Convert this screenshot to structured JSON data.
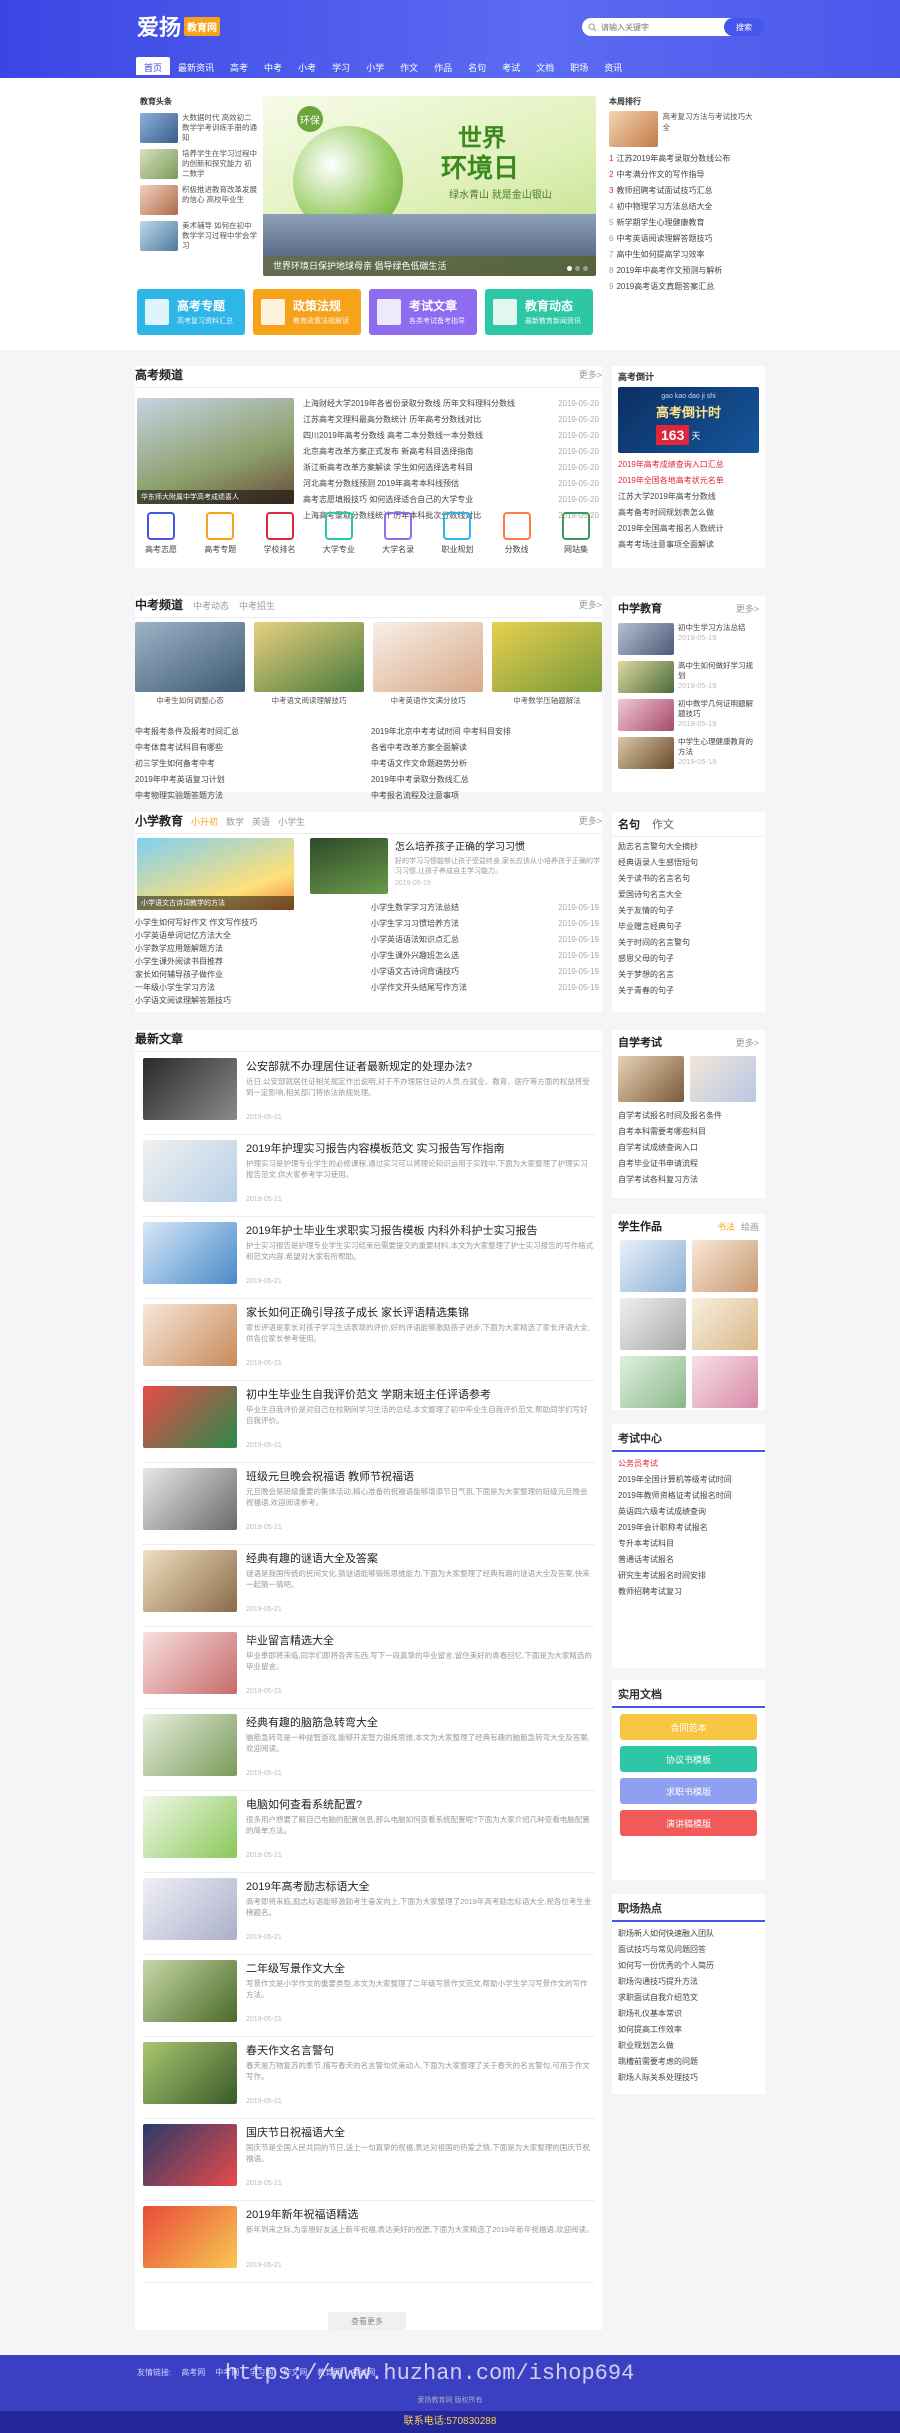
{
  "brand": {
    "name": "爱扬",
    "badge": "教育网"
  },
  "search": {
    "placeholder": "请输入关键字",
    "button": "搜索"
  },
  "nav": [
    "首页",
    "最新资讯",
    "高考",
    "中考",
    "小考",
    "学习",
    "小学",
    "作文",
    "作品",
    "名句",
    "考试",
    "文档",
    "职场",
    "资讯"
  ],
  "hero": {
    "headline_list_title": "教育头条",
    "headlines": [
      "大数据时代 高效初二数学学考训练手册的通知",
      "培养学生在学习过程中的创新和探究能力 初二数学",
      "积极推进教育改革发展的信心 高校毕业生",
      "美术辅导 如何在初中数学学习过程中学会学习"
    ],
    "banner": {
      "tag": "环保",
      "line1": "世界",
      "line2": "环境日",
      "sub": "绿水青山 就是金山银山",
      "caption": "世界环境日保护地球母亲 倡导绿色低碳生活"
    },
    "weekly_title": "本周排行",
    "weekly": [
      "高考复习方法与考试技巧大全",
      "江苏2019年高考录取分数线公布",
      "中考满分作文的写作指导",
      "教师招聘考试面试技巧汇总",
      "初中物理学习方法总结大全",
      "新学期学生心理健康教育",
      "中考英语阅读理解答题技巧",
      "高中生如何提高学习效率",
      "2019年中高考作文预测与解析",
      "2019高考语文真题答案汇总"
    ]
  },
  "cards": [
    {
      "title": "高考专题",
      "sub": "高考复习资料汇总"
    },
    {
      "title": "政策法规",
      "sub": "教育政策法规解读"
    },
    {
      "title": "考试文章",
      "sub": "各类考试备考指导"
    },
    {
      "title": "教育动态",
      "sub": "最新教育新闻资讯"
    }
  ],
  "gaokao": {
    "title": "高考频道",
    "more": "更多>",
    "photo_caption": "华东师大附属中学高考成绩喜人",
    "items": [
      {
        "t": "上海财经大学2019年各省份录取分数线 历年文科理科分数线",
        "d": "2019-05-20"
      },
      {
        "t": "江苏高考文理科最高分数统计 历年高考分数线对比",
        "d": "2019-05-20"
      },
      {
        "t": "四川2019年高考分数线 高考二本分数线一本分数线",
        "d": "2019-05-20"
      },
      {
        "t": "北京高考改革方案正式发布 新高考科目选择指南",
        "d": "2019-05-20"
      },
      {
        "t": "浙江新高考改革方案解读 学生如何选择选考科目",
        "d": "2019-05-20"
      },
      {
        "t": "河北高考分数线预测 2019年高考本科线预估",
        "d": "2019-05-20"
      },
      {
        "t": "高考志愿填报技巧 如何选择适合自己的大学专业",
        "d": "2019-05-20"
      },
      {
        "t": "上海高考录取分数线统计 历年本科批次分数线对比",
        "d": "2019-05-20"
      }
    ],
    "icons": [
      "高考志愿",
      "高考专题",
      "学校排名",
      "大学专业",
      "大学名录",
      "职业规划",
      "分数线",
      "网站集"
    ]
  },
  "countdown": {
    "title": "高考倒计",
    "pinyin": "gao kao dao ji shi",
    "label": "高考倒计时",
    "days": "163",
    "unit": "天",
    "links": [
      "2019年高考成绩查询入口汇总",
      "2019年全国各地高考状元名单",
      "江苏大学2019年高考分数线",
      "高考备考时间规划表怎么做",
      "2019年全国高考报名人数统计",
      "高考考场注意事项全面解读"
    ]
  },
  "zhongkao": {
    "title": "中考频道",
    "tabs": [
      "中考动态",
      "中考招生"
    ],
    "more": "更多>",
    "photos": [
      "中考生如何调整心态",
      "中考语文阅读理解技巧",
      "中考英语作文满分技巧",
      "中考数学压轴题解法"
    ],
    "list_left": [
      "中考报考条件及报考时间汇总",
      "中考体育考试科目有哪些",
      "初三学生如何备考中考",
      "2019年中考英语复习计划",
      "中考物理实验题答题方法"
    ],
    "list_right": [
      "2019年北京中考考试时间 中考科目安排",
      "各省中考改革方案全面解读",
      "中考语文作文命题趋势分析",
      "2019年中考录取分数线汇总",
      "中考报名流程及注意事项"
    ],
    "side_title": "中学教育",
    "side": [
      {
        "t": "初中生学习方法总结",
        "d": "2019-05-19"
      },
      {
        "t": "高中生如何做好学习规划",
        "d": "2019-05-19"
      },
      {
        "t": "初中数学几何证明题解题技巧",
        "d": "2019-05-19"
      },
      {
        "t": "中学生心理健康教育的方法",
        "d": "2019-05-19"
      }
    ]
  },
  "xiaoxue": {
    "title": "小学教育",
    "tabs": [
      "小升初",
      "数学",
      "英语",
      "小学生"
    ],
    "more": "更多>",
    "photo_caption": "小学语文古诗词教学的方法",
    "feature_title": "怎么培养孩子正确的学习习惯",
    "feature_desc": "好的学习习惯能够让孩子受益终身,家长应该从小培养孩子正确的学习习惯,让孩子养成自主学习能力。",
    "feature_date": "2019-05-19",
    "list_left": [
      "小学生如何写好作文 作文写作技巧",
      "小学英语单词记忆方法大全",
      "小学数学应用题解题方法",
      "小学生课外阅读书目推荐",
      "家长如何辅导孩子做作业",
      "一年级小学生学习方法",
      "小学语文阅读理解答题技巧"
    ],
    "list_right": [
      {
        "t": "小学生数学学习方法总结",
        "d": "2019-05-19"
      },
      {
        "t": "小学生学习习惯培养方法",
        "d": "2019-05-19"
      },
      {
        "t": "小学英语语法知识点汇总",
        "d": "2019-05-19"
      },
      {
        "t": "小学生课外兴趣班怎么选",
        "d": "2019-05-19"
      },
      {
        "t": "小学语文古诗词背诵技巧",
        "d": "2019-05-19"
      },
      {
        "t": "小学作文开头结尾写作方法",
        "d": "2019-05-19"
      }
    ],
    "side_tabs": [
      "名句",
      "作文"
    ],
    "side": [
      "励志名言警句大全摘抄",
      "经典语录人生感悟短句",
      "关于读书的名言名句",
      "爱国诗句名言大全",
      "关于友情的句子",
      "毕业赠言经典句子",
      "关于时间的名言警句",
      "感恩父母的句子",
      "关于梦想的名言",
      "关于青春的句子"
    ]
  },
  "latest": {
    "title": "最新文章",
    "more": "查看更多",
    "articles": [
      {
        "t": "公安部就不办理居住证者最新规定的处理办法?",
        "d": "2019-05-21",
        "desc": "近日,公安部就居住证相关规定作出说明,对于不办理居住证的人员,在就业、教育、医疗等方面的权益将受到一定影响,相关部门将依法依规处理。"
      },
      {
        "t": "2019年护理实习报告内容模板范文 实习报告写作指南",
        "d": "2019-05-21",
        "desc": "护理实习是护理专业学生的必修课程,通过实习可以将理论知识运用于实践中,下面为大家整理了护理实习报告范文,供大家参考学习使用。"
      },
      {
        "t": "2019年护士毕业生求职实习报告模板 内科外科护士实习报告",
        "d": "2019-05-21",
        "desc": "护士实习报告是护理专业学生实习结束后需要提交的重要材料,本文为大家整理了护士实习报告的写作格式和范文内容,希望对大家有所帮助。"
      },
      {
        "t": "家长如何正确引导孩子成长 家长评语精选集锦",
        "d": "2019-05-21",
        "desc": "家长评语是家长对孩子学习生活表现的评价,好的评语能够激励孩子进步,下面为大家精选了家长评语大全,供各位家长参考使用。"
      },
      {
        "t": "初中生毕业生自我评价范文 学期末班主任评语参考",
        "d": "2019-05-21",
        "desc": "毕业生自我评价是对自己在校期间学习生活的总结,本文整理了初中毕业生自我评价范文,帮助同学们写好自我评价。"
      },
      {
        "t": "班级元旦晚会祝福语 教师节祝福语",
        "d": "2019-05-21",
        "desc": "元旦晚会是班级重要的集体活动,精心准备的祝福语能够增添节日气氛,下面是为大家整理的班级元旦晚会祝福语,欢迎阅读参考。"
      },
      {
        "t": "经典有趣的谜语大全及答案",
        "d": "2019-05-21",
        "desc": "谜语是我国传统的民间文化,猜谜语能够锻炼思维能力,下面为大家整理了经典有趣的谜语大全及答案,快来一起猜一猜吧。"
      },
      {
        "t": "毕业留言精选大全",
        "d": "2019-05-21",
        "desc": "毕业季即将来临,同学们即将各奔东西,写下一段真挚的毕业留言,留住美好的青春回忆,下面是为大家精选的毕业留言。"
      },
      {
        "t": "经典有趣的脑筋急转弯大全",
        "d": "2019-05-21",
        "desc": "脑筋急转弯是一种益智游戏,能够开发智力锻炼思维,本文为大家整理了经典有趣的脑筋急转弯大全及答案,欢迎阅读。"
      },
      {
        "t": "电脑如何查看系统配置?",
        "d": "2019-05-21",
        "desc": "很多用户想要了解自己电脑的配置信息,那么电脑如何查看系统配置呢?下面为大家介绍几种查看电脑配置的简单方法。"
      },
      {
        "t": "2019年高考励志标语大全",
        "d": "2019-05-21",
        "desc": "高考即将来临,励志标语能够激励考生奋发向上,下面为大家整理了2019年高考励志标语大全,祝各位考生金榜题名。"
      },
      {
        "t": "二年级写景作文大全",
        "d": "2019-05-21",
        "desc": "写景作文是小学作文的重要类型,本文为大家整理了二年级写景作文范文,帮助小学生学习写景作文的写作方法。"
      },
      {
        "t": "春天作文名言警句",
        "d": "2019-05-21",
        "desc": "春天是万物复苏的季节,描写春天的名言警句优美动人,下面为大家整理了关于春天的名言警句,可用于作文写作。"
      },
      {
        "t": "国庆节日祝福语大全",
        "d": "2019-05-21",
        "desc": "国庆节是全国人民共同的节日,送上一句真挚的祝福,表达对祖国的热爱之情,下面是为大家整理的国庆节祝福语。"
      },
      {
        "t": "2019年新年祝福语精选",
        "d": "2019-05-21",
        "desc": "新年到来之际,为亲朋好友送上新年祝福,表达美好的祝愿,下面为大家精选了2019年新年祝福语,欢迎阅读。"
      }
    ]
  },
  "self_exam": {
    "title": "自学考试",
    "more": "更多>",
    "items": [
      "自学考试报名时间及报名条件",
      "自考本科需要考哪些科目",
      "自学考试成绩查询入口",
      "自考毕业证书申请流程",
      "自学考试各科复习方法"
    ]
  },
  "student_work": {
    "title": "学生作品",
    "tabs": [
      "书法",
      "绘画"
    ]
  },
  "exam_center": {
    "title": "考试中心",
    "items": [
      "公务员考试",
      "2019年全国计算机等级考试时间",
      "2019年教师资格证考试报名时间",
      "英语四六级考试成绩查询",
      "2019年会计职称考试报名",
      "专升本考试科目",
      "普通话考试报名",
      "研究生考试报名时间安排",
      "教师招聘考试复习"
    ]
  },
  "docs": {
    "title": "实用文档",
    "buttons": [
      "合同范本",
      "协议书模板",
      "求职书模版",
      "演讲稿模版"
    ]
  },
  "career": {
    "title": "职场热点",
    "items": [
      "职场新人如何快速融入团队",
      "面试技巧与常见问题回答",
      "如何写一份优秀的个人简历",
      "职场沟通技巧提升方法",
      "求职面试自我介绍范文",
      "职场礼仪基本常识",
      "如何提高工作效率",
      "职业规划怎么做",
      "跳槽前需要考虑的问题",
      "职场人际关系处理技巧"
    ]
  },
  "footer": {
    "label": "友情链接:",
    "links": [
      "高考网",
      "中考网",
      "学习网",
      "作文网",
      "教育网",
      "考试网"
    ],
    "watermark": "https://www.huzhan.com/ishop694",
    "copyright": "爱扬教育网 版权所有",
    "bottom": "联系电话:570830288"
  },
  "colors": {
    "primary": "#3a46e4",
    "accent": "#f7a21b",
    "red": "#e0263a"
  }
}
